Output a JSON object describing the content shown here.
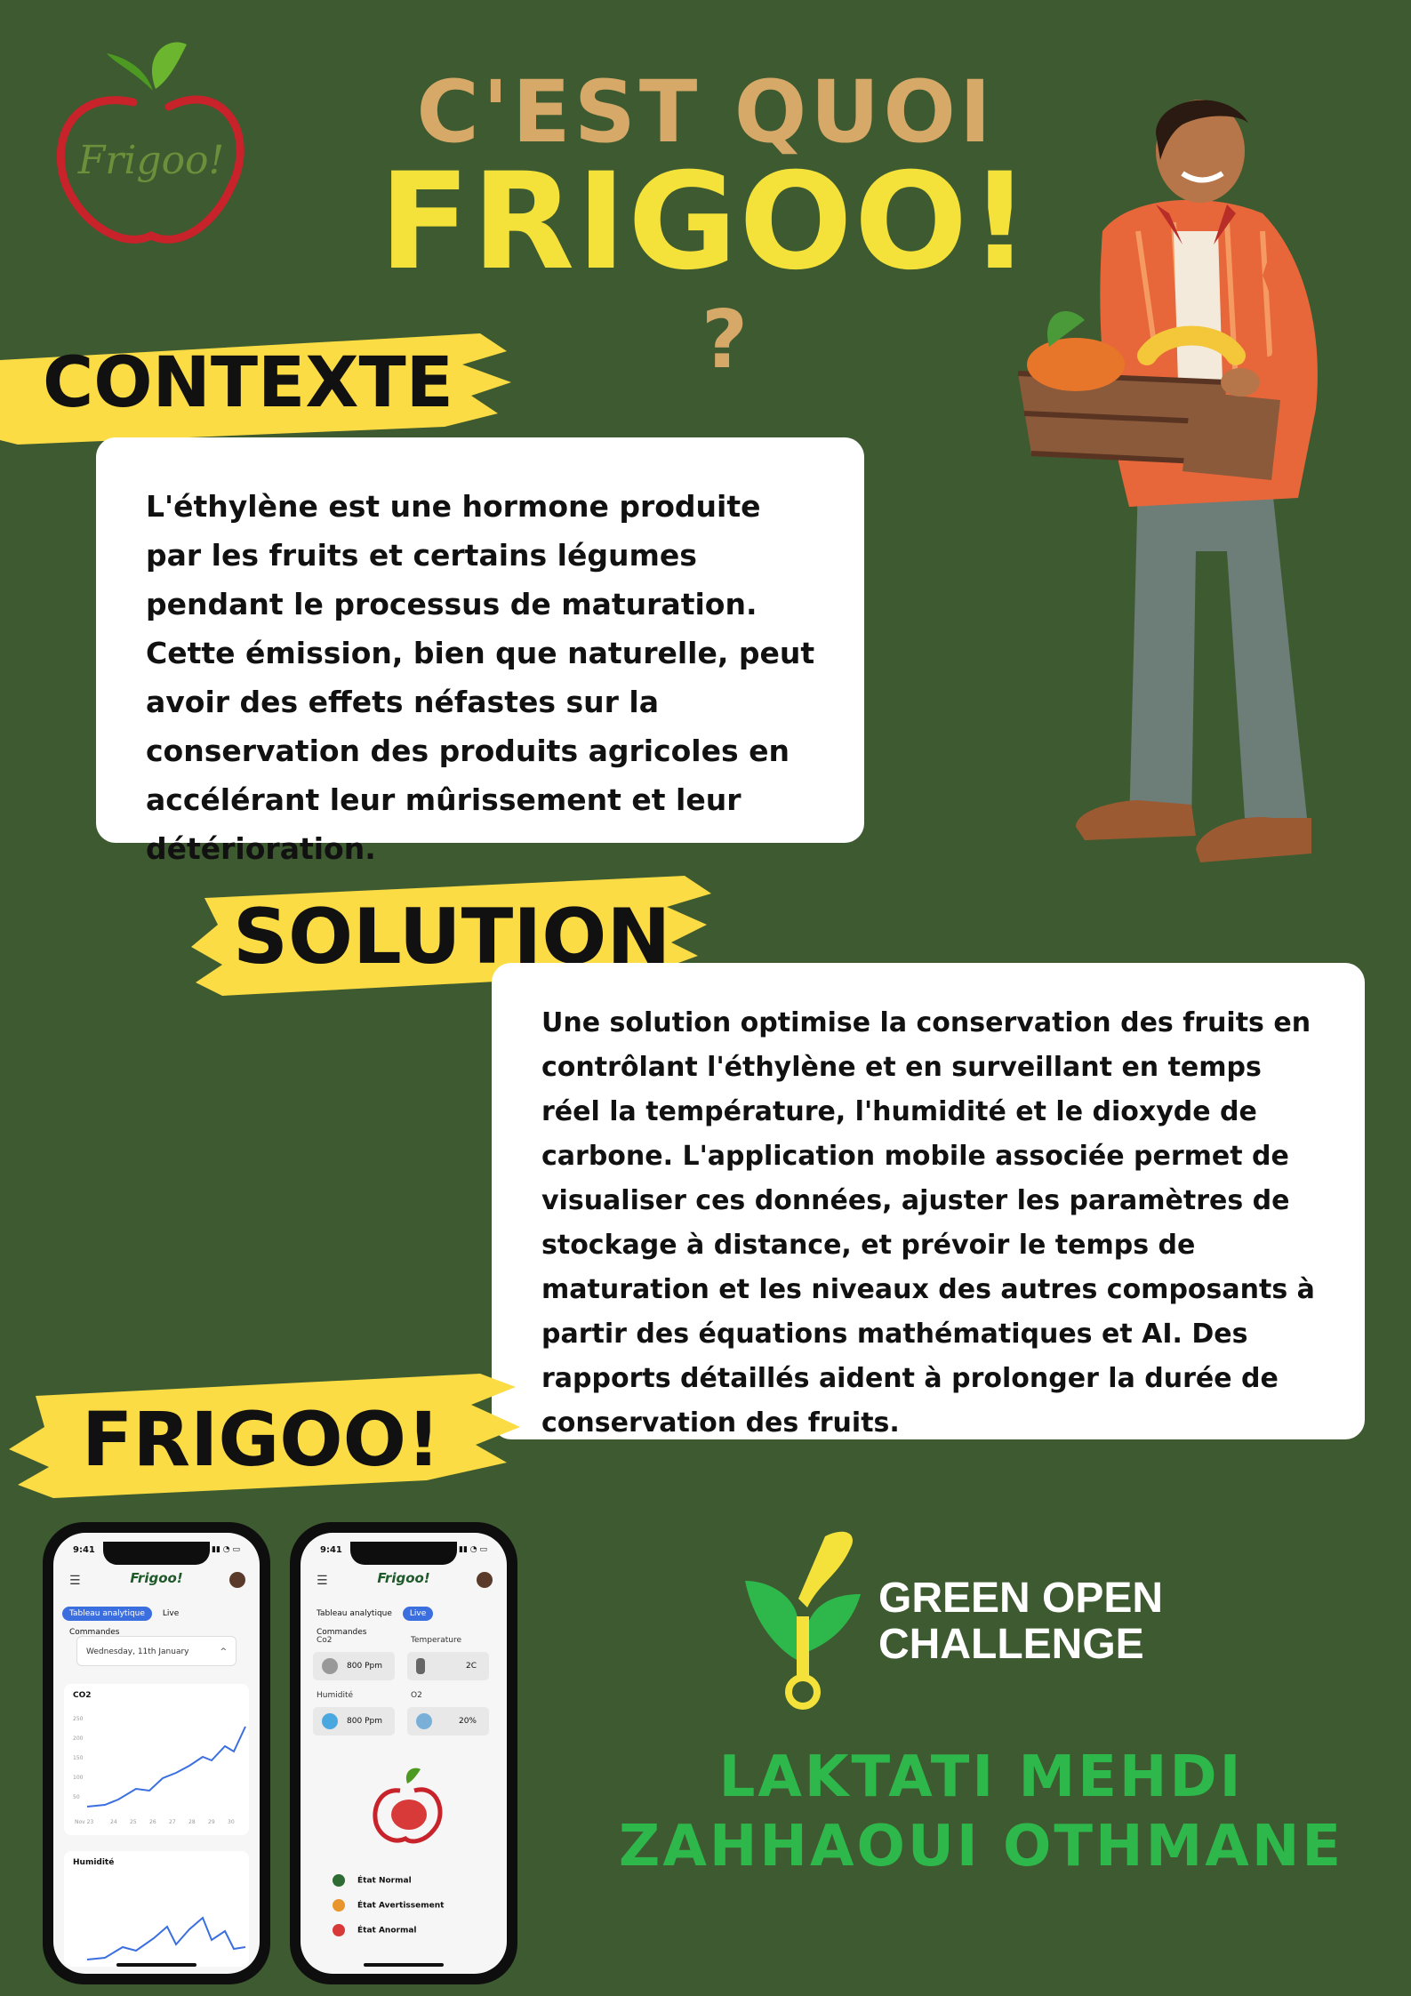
{
  "header": {
    "logo_text": "Frigoo!",
    "title_line1": "C'EST QUOI",
    "title_line2": "FRIGOO!",
    "question_mark": "?"
  },
  "sections": {
    "contexte": {
      "label": "CONTEXTE",
      "text": "L'éthylène est une hormone produite par les fruits et certains légumes pendant le processus de maturation. Cette émission, bien que naturelle, peut avoir des effets néfastes sur la conservation des produits agricoles en accélérant leur mûrissement et leur détérioration."
    },
    "solution": {
      "label": "SOLUTION",
      "text": "Une solution optimise la conservation des fruits en contrôlant l'éthylène et en surveillant en temps réel la température, l'humidité et le dioxyde de carbone. L'application mobile associée permet de visualiser ces données, ajuster les paramètres de stockage à distance, et prévoir le temps de maturation et les niveaux des autres composants à partir des équations mathématiques et AI. Des rapports détaillés aident à prolonger la durée de conservation des fruits."
    },
    "frigoo": {
      "label": "FRIGOO!"
    }
  },
  "phone1": {
    "time": "9:41",
    "logo": "Frigoo!",
    "tabs": [
      "Tableau analytique",
      "Live",
      "Commandes"
    ],
    "date": "Wednesday, 11th January",
    "chart1_title": "CO2",
    "chart2_title": "Humidité",
    "y_ticks": [
      "250",
      "200",
      "150",
      "100",
      "50"
    ],
    "x_ticks": [
      "Nov 23",
      "24",
      "25",
      "26",
      "27",
      "28",
      "29",
      "30"
    ]
  },
  "phone2": {
    "time": "9:41",
    "logo": "Frigoo!",
    "tabs": [
      "Tableau analytique",
      "Live",
      "Commandes"
    ],
    "metrics": [
      {
        "label": "Co2",
        "value": "800 Ppm"
      },
      {
        "label": "Temperature",
        "value": "2C"
      },
      {
        "label": "Humidité",
        "value": "800 Ppm"
      },
      {
        "label": "O2",
        "value": "20%"
      }
    ],
    "legend": [
      {
        "label": "État Normal",
        "color": "#2f6b34"
      },
      {
        "label": "État Avertissement",
        "color": "#e8962c"
      },
      {
        "label": "État Anormal",
        "color": "#d83a3a"
      }
    ]
  },
  "sponsor": {
    "line1": "GREEN OPEN",
    "line2": "CHALLENGE"
  },
  "team": [
    "LAKTATI MEHDI",
    "ZAHHAOUI OTHMANE"
  ],
  "colors": {
    "background": "#3e5a30",
    "title_tan": "#d7a968",
    "title_yellow": "#f4e23a",
    "brush_yellow": "#fbdc44",
    "name_green": "#2eb84b"
  }
}
